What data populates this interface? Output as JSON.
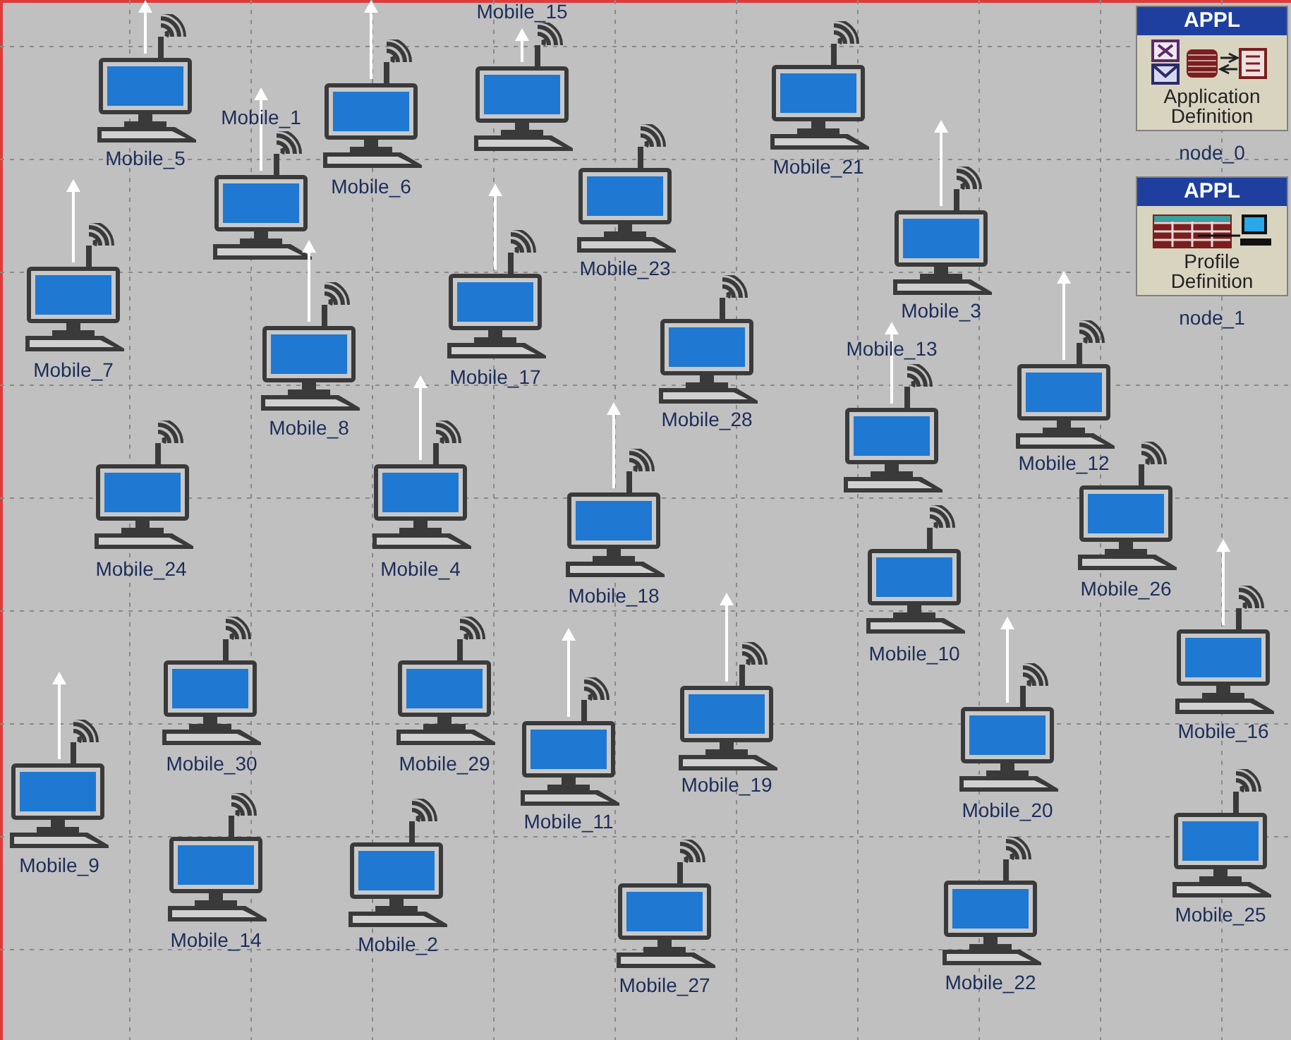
{
  "nodes": [
    {
      "label": "Mobile_15",
      "trajectory": true
    },
    {
      "label": "Mobile_5",
      "trajectory": true
    },
    {
      "label": "Mobile_1",
      "trajectory": true
    },
    {
      "label": "Mobile_6",
      "trajectory": true
    },
    {
      "label": "Mobile_21",
      "trajectory": false
    },
    {
      "label": "Mobile_23",
      "trajectory": false
    },
    {
      "label": "Mobile_3",
      "trajectory": true
    },
    {
      "label": "Mobile_7",
      "trajectory": true
    },
    {
      "label": "Mobile_17",
      "trajectory": true
    },
    {
      "label": "Mobile_8",
      "trajectory": true
    },
    {
      "label": "Mobile_28",
      "trajectory": false
    },
    {
      "label": "Mobile_13",
      "trajectory": true
    },
    {
      "label": "Mobile_12",
      "trajectory": true
    },
    {
      "label": "Mobile_24",
      "trajectory": false
    },
    {
      "label": "Mobile_4",
      "trajectory": true
    },
    {
      "label": "Mobile_18",
      "trajectory": true
    },
    {
      "label": "Mobile_26",
      "trajectory": false
    },
    {
      "label": "Mobile_10",
      "trajectory": false
    },
    {
      "label": "Mobile_16",
      "trajectory": true
    },
    {
      "label": "Mobile_30",
      "trajectory": false
    },
    {
      "label": "Mobile_29",
      "trajectory": false
    },
    {
      "label": "Mobile_11",
      "trajectory": true
    },
    {
      "label": "Mobile_19",
      "trajectory": true
    },
    {
      "label": "Mobile_20",
      "trajectory": true
    },
    {
      "label": "Mobile_9",
      "trajectory": true
    },
    {
      "label": "Mobile_14",
      "trajectory": false
    },
    {
      "label": "Mobile_2",
      "trajectory": false
    },
    {
      "label": "Mobile_27",
      "trajectory": false
    },
    {
      "label": "Mobile_22",
      "trajectory": false
    },
    {
      "label": "Mobile_25",
      "trajectory": false
    }
  ],
  "config_nodes": [
    {
      "kind": "application",
      "badge": "APPL",
      "title_lines": [
        "Application",
        "Definition"
      ],
      "label": "node_0"
    },
    {
      "kind": "profile",
      "badge": "APPL",
      "title_lines": [
        "Profile",
        "Definition"
      ],
      "label": "node_1"
    }
  ]
}
